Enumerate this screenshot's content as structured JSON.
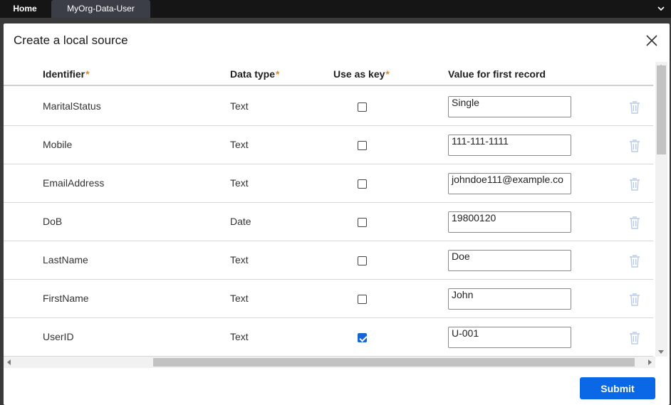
{
  "tabs": [
    {
      "label": "Home"
    },
    {
      "label": "MyOrg-Data-User"
    }
  ],
  "modal": {
    "title": "Create a local source",
    "submit_label": "Submit"
  },
  "table": {
    "headers": {
      "identifier": "Identifier",
      "data_type": "Data type",
      "use_as_key": "Use as key",
      "value": "Value for first record",
      "required_mark": "*"
    },
    "rows": [
      {
        "identifier": "MaritalStatus",
        "data_type": "Text",
        "use_as_key": false,
        "value": "Single"
      },
      {
        "identifier": "Mobile",
        "data_type": "Text",
        "use_as_key": false,
        "value": "111-111-1111"
      },
      {
        "identifier": "EmailAddress",
        "data_type": "Text",
        "use_as_key": false,
        "value": "johndoe111@example.co"
      },
      {
        "identifier": "DoB",
        "data_type": "Date",
        "use_as_key": false,
        "value": "19800120"
      },
      {
        "identifier": "LastName",
        "data_type": "Text",
        "use_as_key": false,
        "value": "Doe"
      },
      {
        "identifier": "FirstName",
        "data_type": "Text",
        "use_as_key": false,
        "value": "John"
      },
      {
        "identifier": "UserID",
        "data_type": "Text",
        "use_as_key": true,
        "value": "U-001"
      }
    ]
  },
  "colors": {
    "primary": "#0a68e6",
    "required": "#e08a26",
    "trash": "#b8cbe6"
  }
}
